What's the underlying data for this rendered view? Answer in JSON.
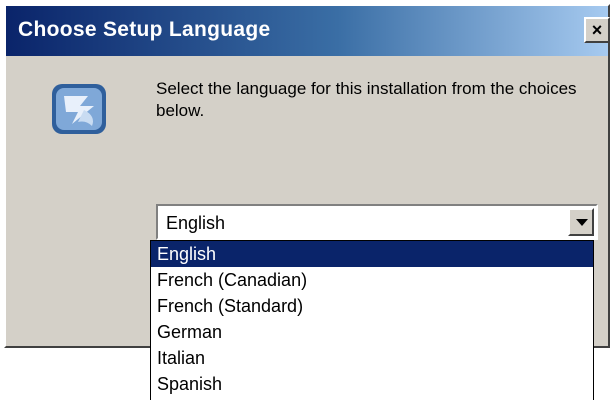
{
  "dialog": {
    "title": "Choose Setup Language",
    "close_label": "×",
    "icon_name": "setup-installer-icon",
    "prompt": "Select the language for this installation from the choices below."
  },
  "language_select": {
    "value": "English",
    "options": [
      {
        "label": "English",
        "selected": true
      },
      {
        "label": "French (Canadian)",
        "selected": false
      },
      {
        "label": "French (Standard)",
        "selected": false
      },
      {
        "label": "German",
        "selected": false
      },
      {
        "label": "Italian",
        "selected": false
      },
      {
        "label": "Spanish",
        "selected": false
      }
    ]
  },
  "colors": {
    "title_bar_start": "#0a246a",
    "title_bar_end": "#a6caf0",
    "dialog_face": "#d4d0c8",
    "selection": "#0a246a"
  }
}
